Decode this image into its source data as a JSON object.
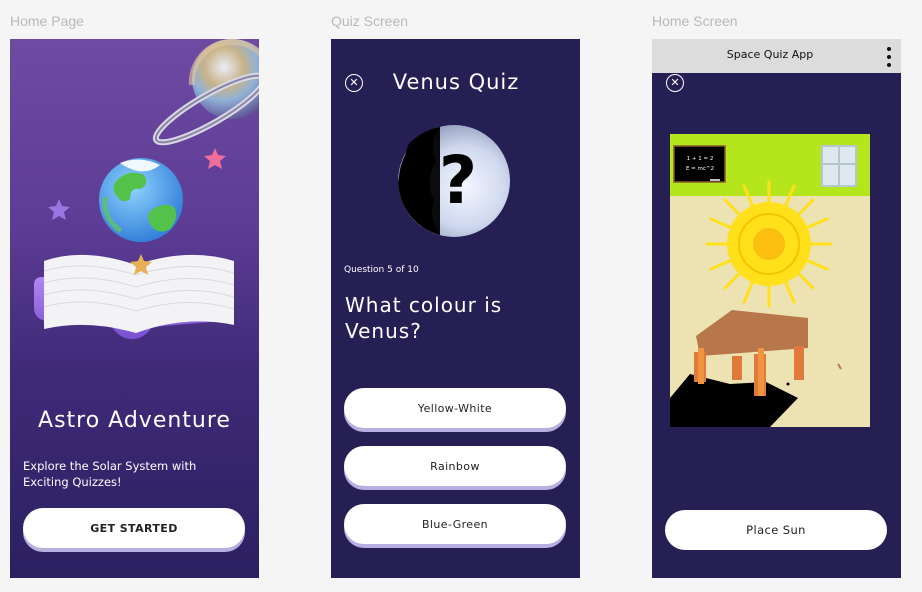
{
  "frames": {
    "home_label": "Home Page",
    "quiz_label": "Quiz Screen",
    "game_label": "Home Screen"
  },
  "home": {
    "title": "Astro Adventure",
    "subtitle": "Explore the Solar System with Exciting Quizzes!",
    "cta": "GET STARTED"
  },
  "quiz": {
    "title": "Venus Quiz",
    "progress": "Question 5 of 10",
    "question": "What colour is Venus?",
    "answers": [
      "Yellow-White",
      "Rainbow",
      "Blue-Green"
    ],
    "close_icon": "close-icon"
  },
  "game": {
    "app_title": "Space Quiz App",
    "board_line1": "1 + 1 = 2",
    "board_line2": "E = mc^2",
    "action": "Place Sun",
    "menu_icon": "more-vertical-icon"
  },
  "colors": {
    "panel_bg": "#261f54",
    "home_gradient_top": "#6f4aa3",
    "button_shadow": "#b9aee0",
    "wall": "#ede3b2",
    "upper_wall": "#b5e61d",
    "sun": "#ffe01a"
  }
}
